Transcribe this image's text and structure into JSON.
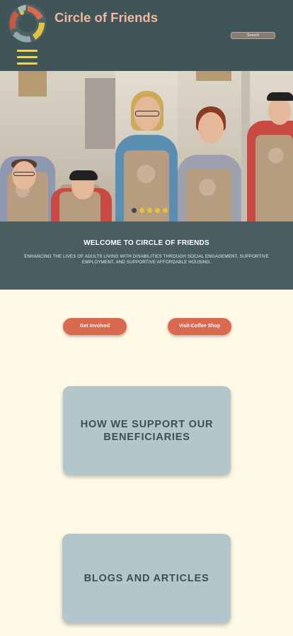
{
  "header": {
    "site_title": "Circle of Friends",
    "search_label": "Search",
    "logo_icon": "circle-of-friends-logo-icon",
    "menu_icon": "hamburger-menu-icon",
    "background": "#3f5557",
    "title_color": "#f0b6a0",
    "menu_color": "#f3d24f"
  },
  "hero": {
    "slide_count": 5,
    "active_slide": 1,
    "dot_colors": [
      "#3d4a4e",
      "#e2c33c",
      "#e2c33c",
      "#e2c33c",
      "#e2c33c"
    ]
  },
  "welcome": {
    "title": "WELCOME TO CIRCLE OF FRIENDS",
    "subtitle_line1": "ENHANCING THE LIVES OF ADULTS LIVING WITH DISABILITIES THROUGH SOCIAL ENGAGEMENT, SUPPORTIVE",
    "subtitle_line2": "EMPLOYMENT, AND SUPPORTIVE AFFORDABLE HOUSING.",
    "background": "#4a5e62"
  },
  "actions": {
    "get_involved": "Get Involved",
    "visit_coffee_shop": "Visit-Coffee Shop",
    "color": "#d96a4f"
  },
  "cards": {
    "support_line1": "HOW WE SUPPORT OUR",
    "support_line2": "BENEFICIARIES",
    "blogs": "BLOGS AND ARTICLES",
    "background": "#b3c6cc"
  },
  "page": {
    "background": "#fff9e6"
  }
}
